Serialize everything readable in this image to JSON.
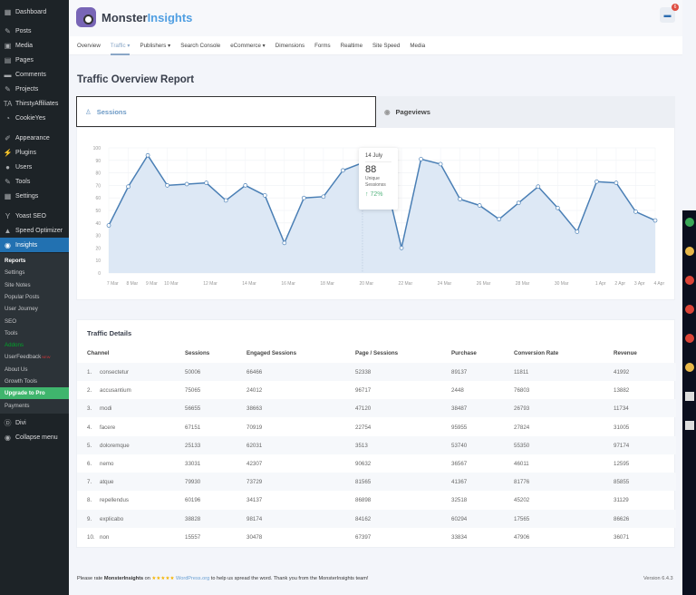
{
  "sidebar": {
    "items": [
      {
        "label": "Dashboard",
        "icon": "dashboard-icon",
        "glyph": "▦"
      },
      {
        "label": "Posts",
        "icon": "pin-icon",
        "glyph": "✎"
      },
      {
        "label": "Media",
        "icon": "media-icon",
        "glyph": "▣"
      },
      {
        "label": "Pages",
        "icon": "pages-icon",
        "glyph": "▤"
      },
      {
        "label": "Comments",
        "icon": "comment-icon",
        "glyph": "▬"
      },
      {
        "label": "Projects",
        "icon": "pin-icon",
        "glyph": "✎"
      },
      {
        "label": "ThirstyAffiliates",
        "icon": "ta-icon",
        "glyph": "TA"
      },
      {
        "label": "CookieYes",
        "icon": "cookie-icon",
        "glyph": "◔"
      },
      {
        "label": "Appearance",
        "icon": "brush-icon",
        "glyph": "✐"
      },
      {
        "label": "Plugins",
        "icon": "plugin-icon",
        "glyph": "⚡"
      },
      {
        "label": "Users",
        "icon": "user-icon",
        "glyph": "●"
      },
      {
        "label": "Tools",
        "icon": "wrench-icon",
        "glyph": "✎"
      },
      {
        "label": "Settings",
        "icon": "settings-icon",
        "glyph": "▦"
      },
      {
        "label": "Yoast SEO",
        "icon": "yoast-icon",
        "glyph": "Y"
      },
      {
        "label": "Speed Optimizer",
        "icon": "speed-icon",
        "glyph": "▲"
      },
      {
        "label": "Insights",
        "icon": "insights-icon",
        "glyph": "◉"
      }
    ],
    "submenu": [
      {
        "label": "Reports"
      },
      {
        "label": "Settings"
      },
      {
        "label": "Site Notes"
      },
      {
        "label": "Popular Posts"
      },
      {
        "label": "User Journey"
      },
      {
        "label": "SEO"
      },
      {
        "label": "Tools"
      },
      {
        "label": "Addons"
      },
      {
        "label": "UserFeedback",
        "badge": "NEW"
      },
      {
        "label": "About Us"
      },
      {
        "label": "Growth Tools"
      },
      {
        "label": "Upgrade to Pro"
      },
      {
        "label": "Payments"
      }
    ],
    "divi": "Divi",
    "collapse": "Collapse menu"
  },
  "header": {
    "brand_1": "Monster",
    "brand_2": "Insights",
    "notifications": "6"
  },
  "nav": [
    "Overview",
    "Traffic ▾",
    "Publishers ▾",
    "Search Console",
    "eCommerce ▾",
    "Dimensions",
    "Forms",
    "Realtime",
    "Site Speed",
    "Media"
  ],
  "page": {
    "title": "Traffic Overview Report",
    "tab_sessions": "Sessions",
    "tab_pageviews": "Pageviews"
  },
  "tooltip": {
    "date": "14 July",
    "value": "88",
    "label": "Unique Sessionss",
    "change": "↑ 72%"
  },
  "chart_data": {
    "type": "area",
    "ylim": [
      0,
      100
    ],
    "yticks": [
      0,
      10,
      20,
      30,
      40,
      50,
      60,
      70,
      80,
      90,
      100
    ],
    "values": [
      38,
      69,
      94,
      70,
      71,
      72,
      58,
      70,
      62,
      24,
      60,
      61,
      82,
      88,
      86,
      20,
      91,
      87,
      59,
      54,
      43,
      56,
      69,
      52,
      33,
      73,
      72,
      49,
      42
    ],
    "xticks": [
      {
        "label": "7 Mar",
        "at": 0.2
      },
      {
        "label": "8 Mar",
        "at": 1.2
      },
      {
        "label": "9 Mar",
        "at": 2.2
      },
      {
        "label": "10 Mar",
        "at": 3.2
      },
      {
        "label": "12 Mar",
        "at": 5.2
      },
      {
        "label": "14 Mar",
        "at": 7.2
      },
      {
        "label": "16 Mar",
        "at": 9.2
      },
      {
        "label": "18 Mar",
        "at": 11.2
      },
      {
        "label": "20 Mar",
        "at": 13.2
      },
      {
        "label": "22 Mar",
        "at": 15.2
      },
      {
        "label": "24 Mar",
        "at": 17.2
      },
      {
        "label": "26 Mar",
        "at": 19.2
      },
      {
        "label": "28 Mar",
        "at": 21.2
      },
      {
        "label": "30 Mar",
        "at": 23.2
      },
      {
        "label": "1 Apr",
        "at": 25.2
      },
      {
        "label": "2 Apr",
        "at": 26.2
      },
      {
        "label": "3 Apr",
        "at": 27.2
      },
      {
        "label": "4 Apr",
        "at": 28.2
      }
    ],
    "highlight_index": 13,
    "grid": true,
    "line_color": "#4a7fb5",
    "fill_color": "#dde8f5"
  },
  "table": {
    "title": "Traffic Details",
    "headers": [
      "Channel",
      "Sessions",
      "Engaged Sessions",
      "Page / Sessions",
      "Purchase",
      "Conversion Rate",
      "Revenue"
    ],
    "rows": [
      [
        "1.",
        "consectetur",
        "50006",
        "66466",
        "52338",
        "89137",
        "11811",
        "41992"
      ],
      [
        "2.",
        "accusantium",
        "75065",
        "24012",
        "96717",
        "2448",
        "76803",
        "13882"
      ],
      [
        "3.",
        "modi",
        "56655",
        "38663",
        "47120",
        "38487",
        "26793",
        "11734"
      ],
      [
        "4.",
        "facere",
        "67151",
        "70919",
        "22754",
        "95955",
        "27824",
        "31005"
      ],
      [
        "5.",
        "doloremque",
        "25133",
        "62031",
        "3513",
        "53740",
        "55350",
        "97174"
      ],
      [
        "6.",
        "nemo",
        "33031",
        "42307",
        "90632",
        "36567",
        "46011",
        "12595"
      ],
      [
        "7.",
        "atque",
        "79930",
        "73729",
        "81565",
        "41367",
        "81776",
        "85855"
      ],
      [
        "8.",
        "repellendus",
        "60196",
        "34137",
        "86898",
        "32518",
        "45202",
        "31129"
      ],
      [
        "9.",
        "explicabo",
        "38828",
        "98174",
        "84162",
        "60294",
        "17565",
        "86626"
      ],
      [
        "10.",
        "non",
        "15557",
        "30478",
        "67397",
        "33834",
        "47906",
        "36071"
      ]
    ]
  },
  "footer": {
    "pre": "Please rate ",
    "brand": "MonsterInsights",
    "on": " on ",
    "stars": "★★★★★",
    "link": "WordPress.org",
    "post": " to help us spread the word. Thank you from the MonsterInsights team!",
    "version": "Version 6.4.3"
  }
}
